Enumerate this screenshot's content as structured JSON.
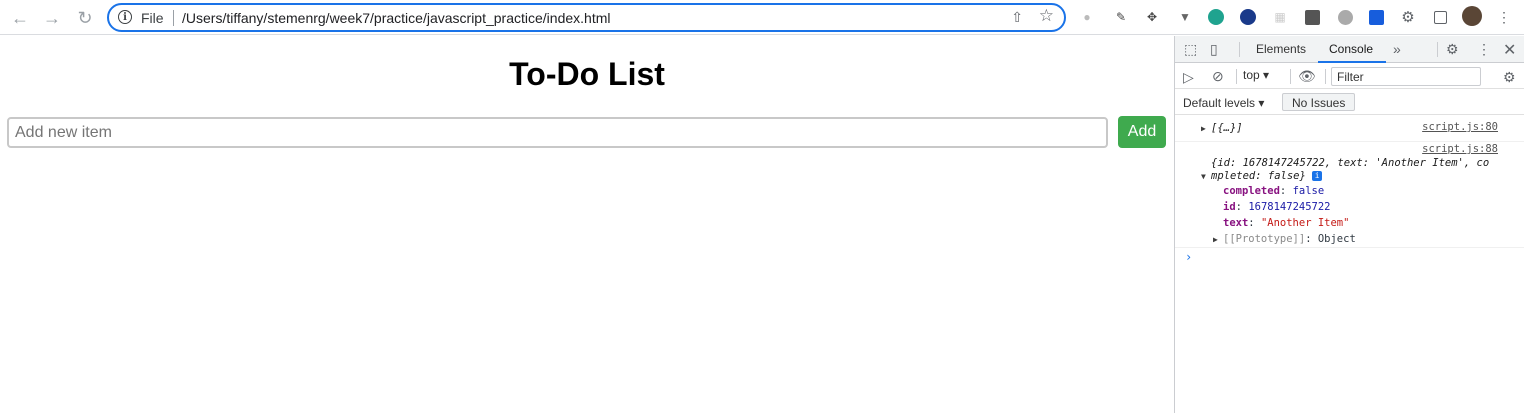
{
  "browser": {
    "url_scheme": "File",
    "url": "/Users/tiffany/stemenrg/week7/practice/javascript_practice/index.html"
  },
  "page": {
    "title": "To-Do List",
    "input_placeholder": "Add new item",
    "add_label": "Add",
    "accent_color": "#3faa4e"
  },
  "devtools": {
    "tabs": [
      "Elements",
      "Console"
    ],
    "active_tab": "Console",
    "context": "top",
    "filter_placeholder": "Filter",
    "levels_label": "Default levels",
    "issues_label": "No Issues",
    "messages": [
      {
        "preview": "[{…}]",
        "source": "script.js:80"
      },
      {
        "source": "script.js:88",
        "preview_line1": "{id: 1678147245722, text: 'Another Item', co",
        "preview_line2": "mpleted: false}",
        "properties": [
          {
            "key": "completed",
            "value": "false"
          },
          {
            "key": "id",
            "value": "1678147245722"
          },
          {
            "key": "text",
            "value": "\"Another Item\""
          },
          {
            "key": "[[Prototype]]",
            "value": "Object"
          }
        ]
      }
    ]
  }
}
